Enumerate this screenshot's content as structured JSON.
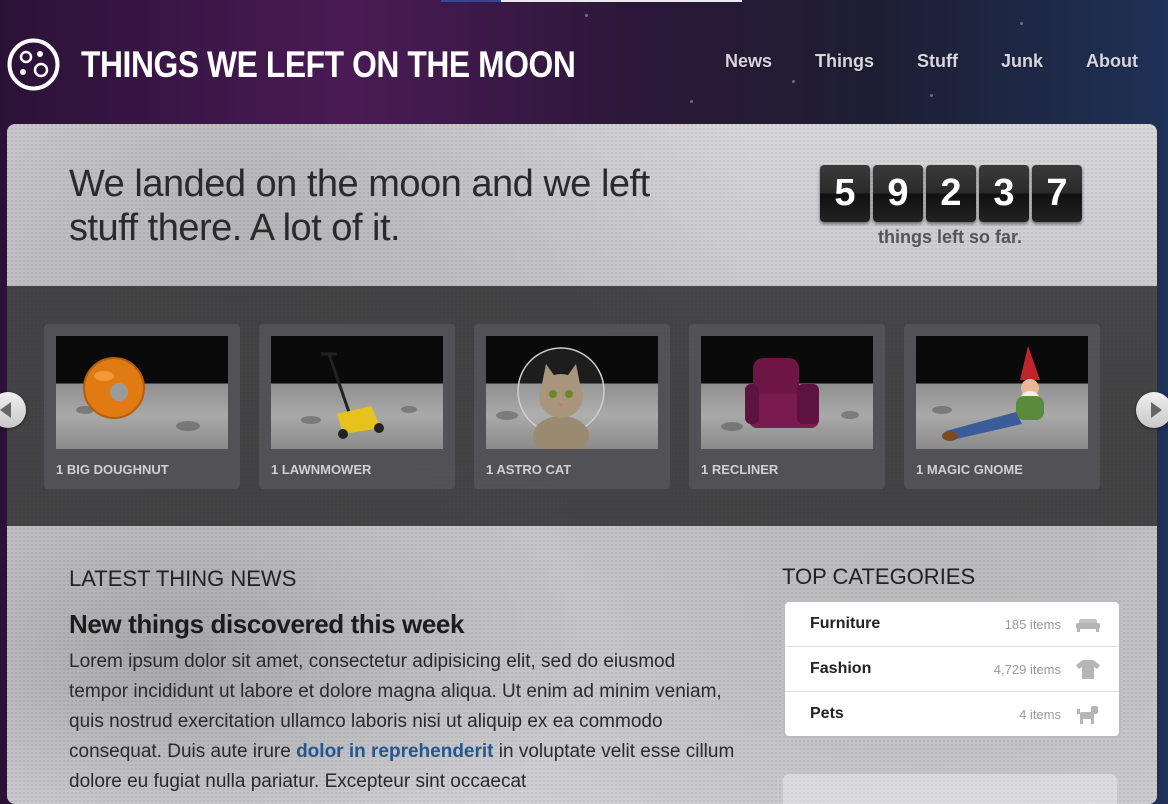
{
  "site": {
    "title": "THINGS WE LEFT ON THE MOON"
  },
  "nav": [
    {
      "label": "News"
    },
    {
      "label": "Things"
    },
    {
      "label": "Stuff"
    },
    {
      "label": "Junk"
    },
    {
      "label": "About"
    }
  ],
  "hero": {
    "headline": "We landed on the moon and we left stuff there. A lot of it.",
    "counter_digits": [
      "5",
      "9",
      "2",
      "3",
      "7"
    ],
    "counter_label": "things left so far."
  },
  "carousel": {
    "items": [
      {
        "caption": "1 BIG DOUGHNUT",
        "icon": "doughnut-image"
      },
      {
        "caption": "1 LAWNMOWER",
        "icon": "lawnmower-image"
      },
      {
        "caption": "1 ASTRO CAT",
        "icon": "astro-cat-image"
      },
      {
        "caption": "1 RECLINER",
        "icon": "recliner-image"
      },
      {
        "caption": "1 MAGIC GNOME",
        "icon": "gnome-image"
      }
    ]
  },
  "news": {
    "heading": "LATEST THING NEWS",
    "title": "New things discovered this week",
    "body_before_link": "Lorem ipsum dolor sit amet, consectetur adipisicing elit, sed do eiusmod tempor incididunt ut labore et dolore magna aliqua. Ut enim ad minim veniam, quis nostrud exercitation ullamco laboris nisi ut aliquip ex ea commodo consequat. Duis aute irure ",
    "link_text": "dolor in reprehenderit",
    "body_after_link": " in voluptate velit esse cillum dolore eu fugiat nulla pariatur. Excepteur sint occaecat"
  },
  "categories": {
    "heading": "TOP CATEGORIES",
    "items": [
      {
        "name": "Furniture",
        "count": "185 items",
        "icon": "sofa-icon"
      },
      {
        "name": "Fashion",
        "count": "4,729 items",
        "icon": "tshirt-icon"
      },
      {
        "name": "Pets",
        "count": "4 items",
        "icon": "dog-icon"
      }
    ]
  },
  "colors": {
    "accent_link": "#24578f",
    "header_purple": "#4a1a55"
  }
}
